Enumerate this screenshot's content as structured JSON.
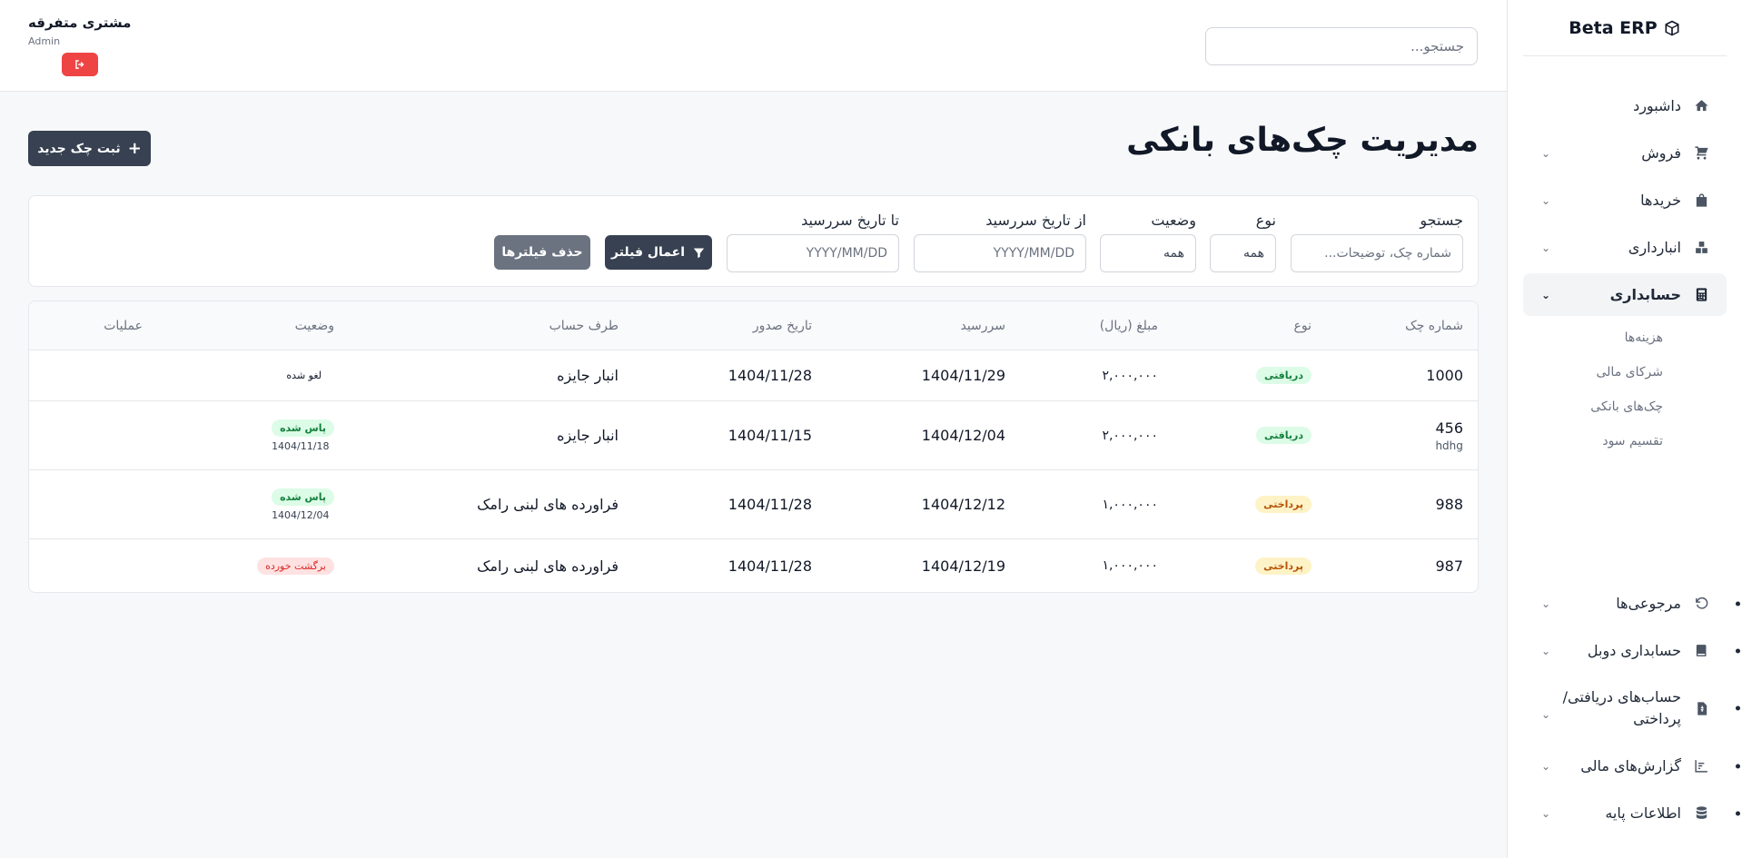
{
  "app": {
    "name": "Beta ERP"
  },
  "sidebar": {
    "items": [
      {
        "label": "داشبورد",
        "icon": "home-icon",
        "chevron": false
      },
      {
        "label": "فروش",
        "icon": "cart-icon",
        "chevron": true
      },
      {
        "label": "خریدها",
        "icon": "bag-icon",
        "chevron": true
      },
      {
        "label": "انبارداری",
        "icon": "boxes-icon",
        "chevron": true
      },
      {
        "label": "حسابداری",
        "icon": "calculator-icon",
        "chevron": true,
        "active": true
      }
    ],
    "subitems": [
      "هزینه‌ها",
      "شرکای مالی",
      "چک‌های بانکی",
      "تقسیم سود"
    ],
    "bottom_items": [
      {
        "label": "مرجوعی‌ها",
        "icon": "undo-icon"
      },
      {
        "label": "حسابداری دوبل",
        "icon": "book-icon"
      },
      {
        "label": "حساب‌های دریافتی/ پرداختی",
        "icon": "invoice-icon"
      },
      {
        "label": "گزارش‌های مالی",
        "icon": "chart-icon"
      },
      {
        "label": "اطلاعات پایه",
        "icon": "database-icon"
      }
    ]
  },
  "header": {
    "search_placeholder": "جستجو...",
    "user_name": "مشتری متفرقه",
    "user_role": "Admin"
  },
  "page": {
    "title": "مدیریت چک‌های بانکی",
    "new_button": "ثبت چک جدید"
  },
  "filters": {
    "search_label": "جستجو",
    "search_placeholder": "شماره چک، توضیحات...",
    "type_label": "نوع",
    "type_value": "همه",
    "status_label": "وضعیت",
    "status_value": "همه",
    "from_label": "از تاریخ سررسید",
    "from_placeholder": "YYYY/MM/DD",
    "to_label": "تا تاریخ سررسید",
    "to_placeholder": "YYYY/MM/DD",
    "apply_button": "اعمال فیلتر",
    "clear_button": "حذف فیلترها"
  },
  "table": {
    "headers": {
      "number": "شماره چک",
      "type": "نوع",
      "amount": "مبلغ (ریال)",
      "due": "سررسید",
      "issue": "تاریخ صدور",
      "party": "طرف حساب",
      "status": "وضعیت",
      "actions": "عملیات"
    },
    "rows": [
      {
        "number": "1000",
        "note": "",
        "type": "دریافتی",
        "amount": "۲,۰۰۰,۰۰۰",
        "due": "1404/11/29",
        "issue": "1404/11/28",
        "party": "انبار جایزه",
        "status": "لغو شده",
        "status_date": ""
      },
      {
        "number": "456",
        "note": "hdhg",
        "type": "دریافتی",
        "amount": "۲,۰۰۰,۰۰۰",
        "due": "1404/12/04",
        "issue": "1404/11/15",
        "party": "انبار جایزه",
        "status": "پاس شده",
        "status_date": "1404/11/18"
      },
      {
        "number": "988",
        "note": "",
        "type": "پرداختی",
        "amount": "۱,۰۰۰,۰۰۰",
        "due": "1404/12/12",
        "issue": "1404/11/28",
        "party": "فراورده های لبنی رامک",
        "status": "پاس شده",
        "status_date": "1404/12/04"
      },
      {
        "number": "987",
        "note": "",
        "type": "پرداختی",
        "amount": "۱,۰۰۰,۰۰۰",
        "due": "1404/12/19",
        "issue": "1404/11/28",
        "party": "فراورده های لبنی رامک",
        "status": "برگشت خورده",
        "status_date": ""
      }
    ]
  },
  "colors": {
    "primary": "#374151",
    "danger": "#ef4444",
    "success_bg": "#dcfce7",
    "warning_bg": "#fef3c7",
    "error_bg": "#fee2e2"
  }
}
